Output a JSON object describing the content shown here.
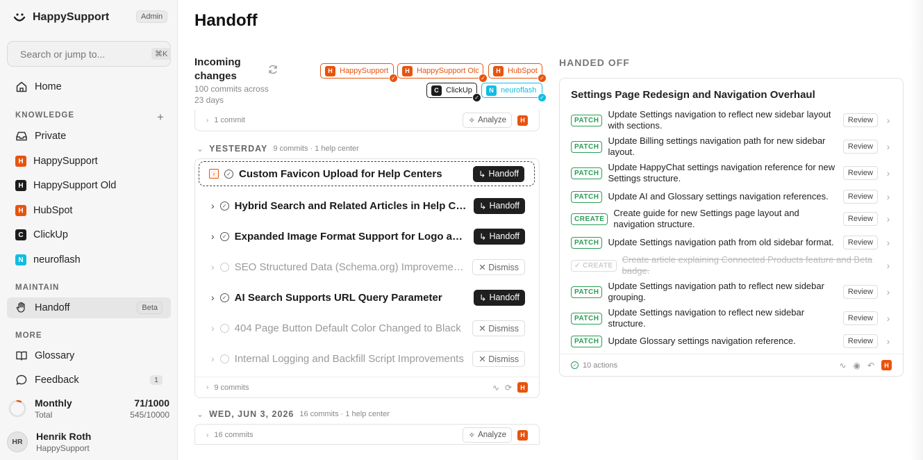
{
  "sidebar": {
    "brand": "HappySupport",
    "admin_badge": "Admin",
    "search_placeholder": "Search or jump to...",
    "search_shortcut": "⌘K",
    "home_label": "Home",
    "knowledge_label": "KNOWLEDGE",
    "knowledge_items": [
      {
        "label": "Private",
        "icon": "inbox-icon"
      },
      {
        "label": "HappySupport",
        "letter": "H",
        "color": "#e8530e"
      },
      {
        "label": "HappySupport Old",
        "letter": "H",
        "color": "#1c1c1c"
      },
      {
        "label": "HubSpot",
        "letter": "H",
        "color": "#e8530e"
      },
      {
        "label": "ClickUp",
        "letter": "C",
        "color": "#1c1c1c"
      },
      {
        "label": "neuroflash",
        "letter": "N",
        "color": "#10bde3"
      }
    ],
    "maintain_label": "MAINTAIN",
    "handoff_label": "Handoff",
    "handoff_badge": "Beta",
    "more_label": "MORE",
    "glossary_label": "Glossary",
    "feedback_label": "Feedback",
    "feedback_count": "1",
    "usage": {
      "label": "Monthly",
      "sub": "Total",
      "value": "71/1000",
      "total": "545/10000",
      "progress": 0.071
    },
    "user": {
      "initials": "HR",
      "name": "Henrik Roth",
      "org": "HappySupport"
    }
  },
  "main": {
    "title": "Handoff",
    "incoming": {
      "title": "Incoming changes",
      "subtitle": "100 commits across 23 days"
    },
    "chips": [
      {
        "letter": "H",
        "label": "HappySupport",
        "style": "o"
      },
      {
        "letter": "H",
        "label": "HappySupport Old",
        "style": "o"
      },
      {
        "letter": "H",
        "label": "HubSpot",
        "style": "o"
      },
      {
        "letter": "C",
        "label": "ClickUp",
        "style": "k"
      },
      {
        "letter": "N",
        "label": "neuroflash",
        "style": "c"
      }
    ],
    "top_card": {
      "commits": "1 commit",
      "analyze": "Analyze"
    },
    "yesterday": {
      "title": "YESTERDAY",
      "sub": "9 commits · 1 help center",
      "items": [
        {
          "title": "Custom Favicon Upload for Help Centers",
          "action": "Handoff",
          "state": "done",
          "selected": true
        },
        {
          "title": "Hybrid Search and Related Articles in Help Center",
          "action": "Handoff",
          "state": "done"
        },
        {
          "title": "Expanded Image Format Support for Logo and Favicon",
          "action": "Handoff",
          "state": "done"
        },
        {
          "title": "SEO Structured Data (Schema.org) Improvements",
          "action": "Dismiss",
          "state": "pending"
        },
        {
          "title": "AI Search Supports URL Query Parameter",
          "action": "Handoff",
          "state": "done"
        },
        {
          "title": "404 Page Button Default Color Changed to Black",
          "action": "Dismiss",
          "state": "pending"
        },
        {
          "title": "Internal Logging and Backfill Script Improvements",
          "action": "Dismiss",
          "state": "pending"
        }
      ],
      "footer": "9 commits"
    },
    "wed": {
      "title": "WED, JUN 3, 2026",
      "sub": "16 commits · 1 help center",
      "commits": "16 commits",
      "analyze": "Analyze"
    }
  },
  "handed_off": {
    "label": "HANDED OFF",
    "card_title": "Settings Page Redesign and Navigation Overhaul",
    "review_label": "Review",
    "actions": [
      {
        "tag": "PATCH",
        "text": "Update Settings navigation to reflect new sidebar layout with sections."
      },
      {
        "tag": "PATCH",
        "text": "Update Billing settings navigation path for new sidebar layout."
      },
      {
        "tag": "PATCH",
        "text": "Update HappyChat settings navigation reference for new Settings structure."
      },
      {
        "tag": "PATCH",
        "text": "Update AI and Glossary settings navigation references."
      },
      {
        "tag": "CREATE",
        "text": "Create guide for new Settings page layout and navigation structure."
      },
      {
        "tag": "PATCH",
        "text": "Update Settings navigation path from old sidebar format."
      },
      {
        "tag": "CREATE",
        "text": "Create article explaining Connected Products feature and Beta badge.",
        "dismissed": true
      },
      {
        "tag": "PATCH",
        "text": "Update Settings navigation path to reflect new sidebar grouping."
      },
      {
        "tag": "PATCH",
        "text": "Update Settings navigation to reflect new sidebar structure."
      },
      {
        "tag": "PATCH",
        "text": "Update Glossary settings navigation reference."
      }
    ],
    "footer": "10 actions"
  }
}
